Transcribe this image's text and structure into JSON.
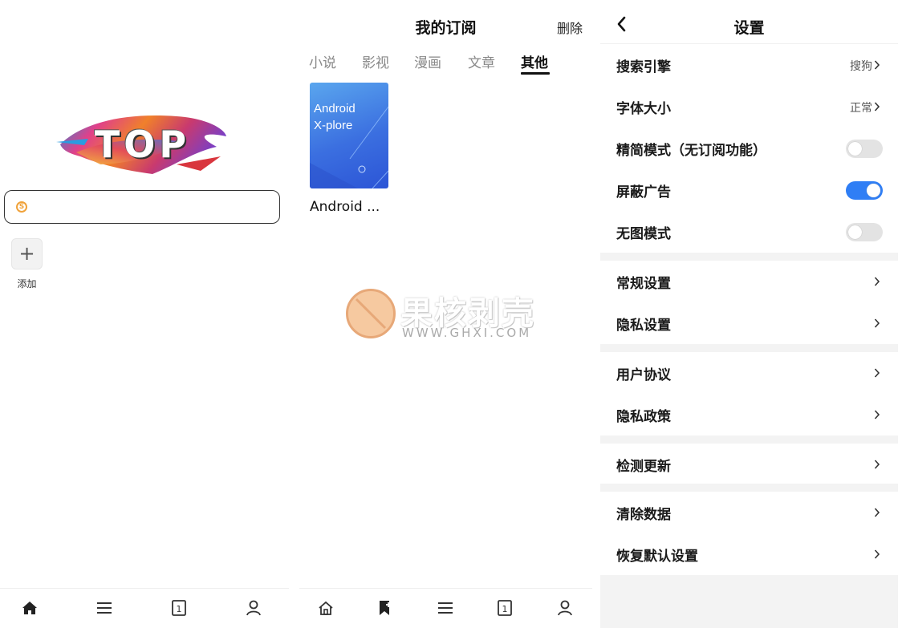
{
  "home": {
    "logo_text": "TOP",
    "search_engine_icon": "sogou-icon",
    "add_icon": "plus-icon",
    "add_label": "添加",
    "nav": [
      "home-icon",
      "menu-icon",
      "tabs-icon",
      "profile-icon"
    ]
  },
  "subscriptions": {
    "title": "我的订阅",
    "delete_label": "删除",
    "tabs": [
      "小说",
      "影视",
      "漫画",
      "文章",
      "其他"
    ],
    "active_tab": "其他",
    "items": [
      {
        "cover_line1": "Android",
        "cover_line2": "X-plore",
        "name": "Android ..."
      }
    ],
    "watermark_cn": "果核剥壳",
    "watermark_en": "WWW.GHXI.COM",
    "nav": [
      "home-icon",
      "bookmark-add-icon",
      "menu-icon",
      "tabs-icon",
      "profile-icon"
    ]
  },
  "settings": {
    "title": "设置",
    "rows": [
      {
        "label": "搜索引擎",
        "value": "搜狗"
      },
      {
        "label": "字体大小",
        "value": "正常"
      },
      {
        "label": "精简模式（无订阅功能）",
        "toggle": false
      },
      {
        "label": "屏蔽广告",
        "toggle": true
      },
      {
        "label": "无图模式",
        "toggle": false
      },
      {
        "label": "常规设置"
      },
      {
        "label": "隐私设置"
      },
      {
        "label": "用户协议"
      },
      {
        "label": "隐私政策"
      },
      {
        "label": "检测更新"
      },
      {
        "label": "清除数据"
      },
      {
        "label": "恢复默认设置"
      }
    ],
    "accent_color": "#2f7ef5"
  }
}
